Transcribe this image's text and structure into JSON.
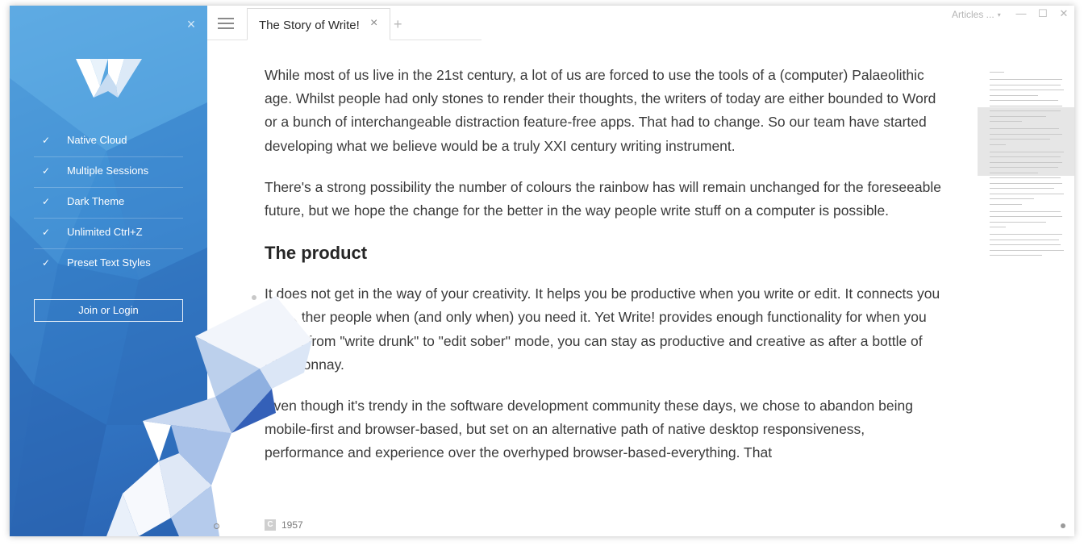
{
  "sidebar": {
    "close_icon": "×",
    "features": [
      {
        "check": "✓",
        "label": "Native Cloud"
      },
      {
        "check": "✓",
        "label": "Multiple Sessions"
      },
      {
        "check": "✓",
        "label": "Dark Theme"
      },
      {
        "check": "✓",
        "label": "Unlimited Ctrl+Z"
      },
      {
        "check": "✓",
        "label": "Preset Text Styles"
      }
    ],
    "login_label": "Join or Login",
    "colors": {
      "gradient_top": "#5aa6e0",
      "gradient_bottom": "#2a63b2"
    }
  },
  "tabs": [
    {
      "title": "The Story of Write!",
      "close": "×",
      "active": true
    }
  ],
  "tab_add": "+",
  "header": {
    "articles_label": "Articles ...",
    "caret": "▾",
    "minimize": "—",
    "maximize": "☐",
    "close": "✕"
  },
  "document": {
    "paragraphs": [
      "While most of us live in the 21st century, a lot of us are forced to use the tools of a (computer) Palaeolithic age. Whilst people had only stones to render their thoughts, the writers of today are either bounded to Word or a bunch of interchangeable distraction feature-free apps. That had to change. So our team have started developing what we believe would be a truly XXI century writing instrument.",
      "There's a strong possibility the number of colours the rainbow has will remain unchanged for the foreseeable future, but we hope the change for the better in the way people write stuff on a computer is possible."
    ],
    "heading": "The product",
    "paragraphs_after": [
      "It does not get in the way of your creativity. It helps you be productive when you write or edit. It connects you with other people when (and only when) you need it. Yet Write! provides enough functionality for when you switch from \"write drunk\" to \"edit sober\" mode, you can stay as productive and creative as after a bottle of Chardonnay.",
      "Even though it's trendy in the software development community these days, we chose to abandon being mobile-first and browser-based, but set on an alternative path of native desktop responsiveness, performance and experience over the overhyped browser-based-everything. That"
    ]
  },
  "status": {
    "count_icon": "C",
    "word_count": "1957"
  }
}
